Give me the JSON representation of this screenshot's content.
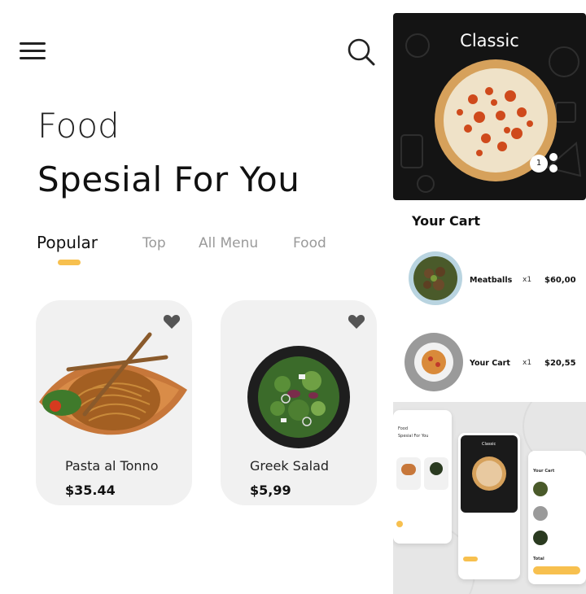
{
  "header": {
    "menu_icon": "hamburger-menu-icon",
    "search_icon": "search-icon"
  },
  "headline": {
    "line1": "Food",
    "line2": "Spesial For You"
  },
  "tabs": [
    {
      "label": "Popular",
      "active": true
    },
    {
      "label": "Top",
      "active": false
    },
    {
      "label": "All Menu",
      "active": false
    },
    {
      "label": "Food",
      "active": false
    }
  ],
  "products": [
    {
      "name": "Pasta al Tonno",
      "price": "$35.44",
      "icon": "heart-icon"
    },
    {
      "name": "Greek Salad",
      "price": "$5,99",
      "icon": "heart-icon"
    }
  ],
  "detail": {
    "title": "Classic",
    "quantity": "1"
  },
  "cart": {
    "title": "Your Cart",
    "items": [
      {
        "name": "Meatballs",
        "qty": "x1",
        "price": "$60,00"
      },
      {
        "name": "Your Cart",
        "qty": "x1",
        "price": "$20,55"
      }
    ]
  },
  "preview": {
    "food": "Food",
    "spesial": "Spesial For You",
    "classic": "Classic",
    "your_cart": "Your Cart",
    "total": "Total"
  },
  "colors": {
    "accent": "#f7c04f",
    "card_bg": "#f1f1f1",
    "dark_bg": "#141414"
  }
}
